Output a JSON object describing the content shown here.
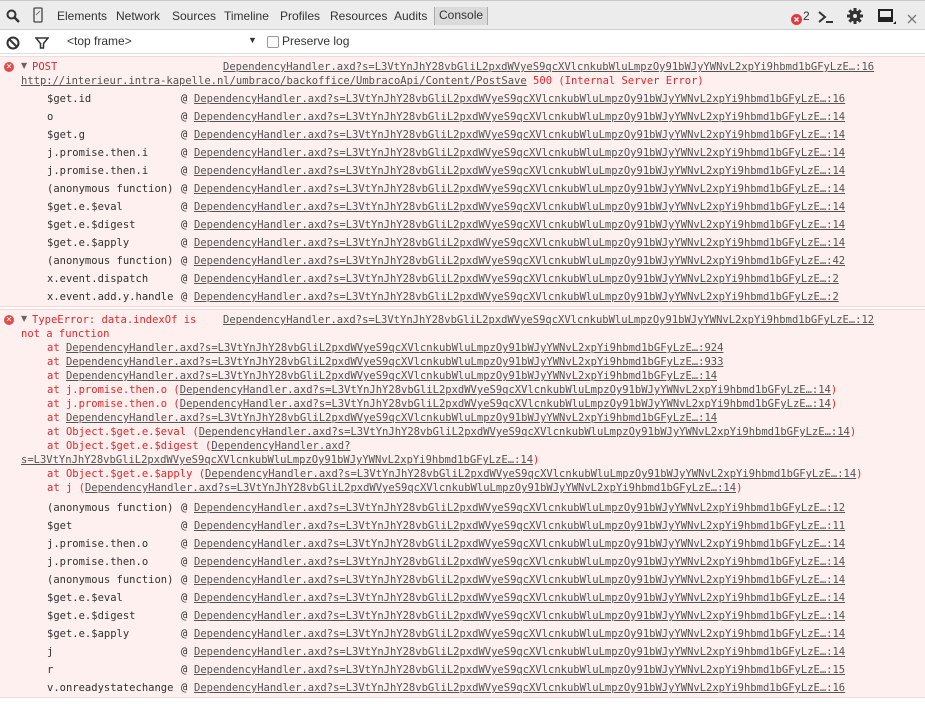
{
  "devtools": {
    "tabs": [
      {
        "label": "Elements",
        "active": false
      },
      {
        "label": "Network",
        "active": false
      },
      {
        "label": "Sources",
        "active": false
      },
      {
        "label": "Timeline",
        "active": false
      },
      {
        "label": "Profiles",
        "active": false
      },
      {
        "label": "Resources",
        "active": false
      },
      {
        "label": "Audits",
        "active": false
      },
      {
        "label": "Console",
        "active": true
      }
    ],
    "error_count": "2",
    "icons": {
      "left": [
        "search-icon",
        "device-mode-icon"
      ],
      "right": [
        "error-badge-icon",
        "console-drawer-icon",
        "settings-gear-icon",
        "dock-side-icon",
        "close-icon"
      ]
    }
  },
  "console_toolbar": {
    "frame_select": "<top frame>",
    "preserve_log_label": "Preserve log",
    "preserve_log_checked": false
  },
  "colors": {
    "error_text": "#e1262c",
    "error_bg": "#fff0f0",
    "error_border": "#f8d7d7",
    "tabbar_bg": "#ececec"
  },
  "messages": [
    {
      "type": "error",
      "expanded": true,
      "title": "POST",
      "source": "DependencyHandler.axd?s=L3VtYnJhY28vbGliL2pxdWVyeS9qcXVlcnkubWluLmpzOy91bWJyYWNvL2xpYi9hbmd1bGFyLzE…:16",
      "url": "http://interieur.intra-kapelle.nl/umbraco/backoffice/UmbracoApi/Content/PostSave",
      "status": "500 (Internal Server Error)",
      "stack": [
        {
          "fn": "$get.id",
          "loc": "DependencyHandler.axd?s=L3VtYnJhY28vbGliL2pxdWVyeS9qcXVlcnkubWluLmpzOy91bWJyYWNvL2xpYi9hbmd1bGFyLzE…:16"
        },
        {
          "fn": "o",
          "loc": "DependencyHandler.axd?s=L3VtYnJhY28vbGliL2pxdWVyeS9qcXVlcnkubWluLmpzOy91bWJyYWNvL2xpYi9hbmd1bGFyLzE…:14"
        },
        {
          "fn": "$get.g",
          "loc": "DependencyHandler.axd?s=L3VtYnJhY28vbGliL2pxdWVyeS9qcXVlcnkubWluLmpzOy91bWJyYWNvL2xpYi9hbmd1bGFyLzE…:14"
        },
        {
          "fn": "j.promise.then.i",
          "loc": "DependencyHandler.axd?s=L3VtYnJhY28vbGliL2pxdWVyeS9qcXVlcnkubWluLmpzOy91bWJyYWNvL2xpYi9hbmd1bGFyLzE…:14"
        },
        {
          "fn": "j.promise.then.i",
          "loc": "DependencyHandler.axd?s=L3VtYnJhY28vbGliL2pxdWVyeS9qcXVlcnkubWluLmpzOy91bWJyYWNvL2xpYi9hbmd1bGFyLzE…:14"
        },
        {
          "fn": "(anonymous function)",
          "loc": "DependencyHandler.axd?s=L3VtYnJhY28vbGliL2pxdWVyeS9qcXVlcnkubWluLmpzOy91bWJyYWNvL2xpYi9hbmd1bGFyLzE…:14"
        },
        {
          "fn": "$get.e.$eval",
          "loc": "DependencyHandler.axd?s=L3VtYnJhY28vbGliL2pxdWVyeS9qcXVlcnkubWluLmpzOy91bWJyYWNvL2xpYi9hbmd1bGFyLzE…:14"
        },
        {
          "fn": "$get.e.$digest",
          "loc": "DependencyHandler.axd?s=L3VtYnJhY28vbGliL2pxdWVyeS9qcXVlcnkubWluLmpzOy91bWJyYWNvL2xpYi9hbmd1bGFyLzE…:14"
        },
        {
          "fn": "$get.e.$apply",
          "loc": "DependencyHandler.axd?s=L3VtYnJhY28vbGliL2pxdWVyeS9qcXVlcnkubWluLmpzOy91bWJyYWNvL2xpYi9hbmd1bGFyLzE…:14"
        },
        {
          "fn": "(anonymous function)",
          "loc": "DependencyHandler.axd?s=L3VtYnJhY28vbGliL2pxdWVyeS9qcXVlcnkubWluLmpzOy91bWJyYWNvL2xpYi9hbmd1bGFyLzE…:42"
        },
        {
          "fn": "x.event.dispatch",
          "loc": "DependencyHandler.axd?s=L3VtYnJhY28vbGliL2pxdWVyeS9qcXVlcnkubWluLmpzOy91bWJyYWNvL2xpYi9hbmd1bGFyLzE…:2"
        },
        {
          "fn": "x.event.add.y.handle",
          "loc": "DependencyHandler.axd?s=L3VtYnJhY28vbGliL2pxdWVyeS9qcXVlcnkubWluLmpzOy91bWJyYWNvL2xpYi9hbmd1bGFyLzE…:2"
        }
      ]
    },
    {
      "type": "error",
      "expanded": true,
      "title_line1": "TypeError: data.indexOf is",
      "title_line2": "not a function",
      "source": "DependencyHandler.axd?s=L3VtYnJhY28vbGliL2pxdWVyeS9qcXVlcnkubWluLmpzOy91bWJyYWNvL2xpYi9hbmd1bGFyLzE…:12",
      "at_lines": [
        {
          "prefix": "at ",
          "fn": "",
          "loc": "DependencyHandler.axd?s=L3VtYnJhY28vbGliL2pxdWVyeS9qcXVlcnkubWluLmpzOy91bWJyYWNvL2xpYi9hbmd1bGFyLzE…:924"
        },
        {
          "prefix": "at ",
          "fn": "",
          "loc": "DependencyHandler.axd?s=L3VtYnJhY28vbGliL2pxdWVyeS9qcXVlcnkubWluLmpzOy91bWJyYWNvL2xpYi9hbmd1bGFyLzE…:933"
        },
        {
          "prefix": "at ",
          "fn": "",
          "loc": "DependencyHandler.axd?s=L3VtYnJhY28vbGliL2pxdWVyeS9qcXVlcnkubWluLmpzOy91bWJyYWNvL2xpYi9hbmd1bGFyLzE…:14"
        },
        {
          "prefix": "at ",
          "fn": "j.promise.then.o",
          "loc": "DependencyHandler.axd?s=L3VtYnJhY28vbGliL2pxdWVyeS9qcXVlcnkubWluLmpzOy91bWJyYWNvL2xpYi9hbmd1bGFyLzE…:14"
        },
        {
          "prefix": "at ",
          "fn": "j.promise.then.o",
          "loc": "DependencyHandler.axd?s=L3VtYnJhY28vbGliL2pxdWVyeS9qcXVlcnkubWluLmpzOy91bWJyYWNvL2xpYi9hbmd1bGFyLzE…:14"
        },
        {
          "prefix": "at ",
          "fn": "",
          "loc": "DependencyHandler.axd?s=L3VtYnJhY28vbGliL2pxdWVyeS9qcXVlcnkubWluLmpzOy91bWJyYWNvL2xpYi9hbmd1bGFyLzE…:14"
        },
        {
          "prefix": "at ",
          "fn": "Object.$get.e.$eval",
          "loc": "DependencyHandler.axd?s=L3VtYnJhY28vbGliL2pxdWVyeS9qcXVlcnkubWluLmpzOy91bWJyYWNvL2xpYi9hbmd1bGFyLzE…:14"
        },
        {
          "prefix": "at ",
          "fn": "Object.$get.e.$digest",
          "loc_part1": "DependencyHandler.axd?",
          "loc_part2": "s=L3VtYnJhY28vbGliL2pxdWVyeS9qcXVlcnkubWluLmpzOy91bWJyYWNvL2xpYi9hbmd1bGFyLzE…:14"
        },
        {
          "prefix": "at ",
          "fn": "Object.$get.e.$apply",
          "loc": "DependencyHandler.axd?s=L3VtYnJhY28vbGliL2pxdWVyeS9qcXVlcnkubWluLmpzOy91bWJyYWNvL2xpYi9hbmd1bGFyLzE…:14"
        },
        {
          "prefix": "at ",
          "fn": "j",
          "loc": "DependencyHandler.axd?s=L3VtYnJhY28vbGliL2pxdWVyeS9qcXVlcnkubWluLmpzOy91bWJyYWNvL2xpYi9hbmd1bGFyLzE…:14"
        }
      ],
      "stack": [
        {
          "fn": "(anonymous function)",
          "loc": "DependencyHandler.axd?s=L3VtYnJhY28vbGliL2pxdWVyeS9qcXVlcnkubWluLmpzOy91bWJyYWNvL2xpYi9hbmd1bGFyLzE…:12"
        },
        {
          "fn": "$get",
          "loc": "DependencyHandler.axd?s=L3VtYnJhY28vbGliL2pxdWVyeS9qcXVlcnkubWluLmpzOy91bWJyYWNvL2xpYi9hbmd1bGFyLzE…:11"
        },
        {
          "fn": "j.promise.then.o",
          "loc": "DependencyHandler.axd?s=L3VtYnJhY28vbGliL2pxdWVyeS9qcXVlcnkubWluLmpzOy91bWJyYWNvL2xpYi9hbmd1bGFyLzE…:14"
        },
        {
          "fn": "j.promise.then.o",
          "loc": "DependencyHandler.axd?s=L3VtYnJhY28vbGliL2pxdWVyeS9qcXVlcnkubWluLmpzOy91bWJyYWNvL2xpYi9hbmd1bGFyLzE…:14"
        },
        {
          "fn": "(anonymous function)",
          "loc": "DependencyHandler.axd?s=L3VtYnJhY28vbGliL2pxdWVyeS9qcXVlcnkubWluLmpzOy91bWJyYWNvL2xpYi9hbmd1bGFyLzE…:14"
        },
        {
          "fn": "$get.e.$eval",
          "loc": "DependencyHandler.axd?s=L3VtYnJhY28vbGliL2pxdWVyeS9qcXVlcnkubWluLmpzOy91bWJyYWNvL2xpYi9hbmd1bGFyLzE…:14"
        },
        {
          "fn": "$get.e.$digest",
          "loc": "DependencyHandler.axd?s=L3VtYnJhY28vbGliL2pxdWVyeS9qcXVlcnkubWluLmpzOy91bWJyYWNvL2xpYi9hbmd1bGFyLzE…:14"
        },
        {
          "fn": "$get.e.$apply",
          "loc": "DependencyHandler.axd?s=L3VtYnJhY28vbGliL2pxdWVyeS9qcXVlcnkubWluLmpzOy91bWJyYWNvL2xpYi9hbmd1bGFyLzE…:14"
        },
        {
          "fn": "j",
          "loc": "DependencyHandler.axd?s=L3VtYnJhY28vbGliL2pxdWVyeS9qcXVlcnkubWluLmpzOy91bWJyYWNvL2xpYi9hbmd1bGFyLzE…:14"
        },
        {
          "fn": "r",
          "loc": "DependencyHandler.axd?s=L3VtYnJhY28vbGliL2pxdWVyeS9qcXVlcnkubWluLmpzOy91bWJyYWNvL2xpYi9hbmd1bGFyLzE…:15"
        },
        {
          "fn": "v.onreadystatechange",
          "loc": "DependencyHandler.axd?s=L3VtYnJhY28vbGliL2pxdWVyeS9qcXVlcnkubWluLmpzOy91bWJyYWNvL2xpYi9hbmd1bGFyLzE…:16"
        }
      ]
    }
  ]
}
